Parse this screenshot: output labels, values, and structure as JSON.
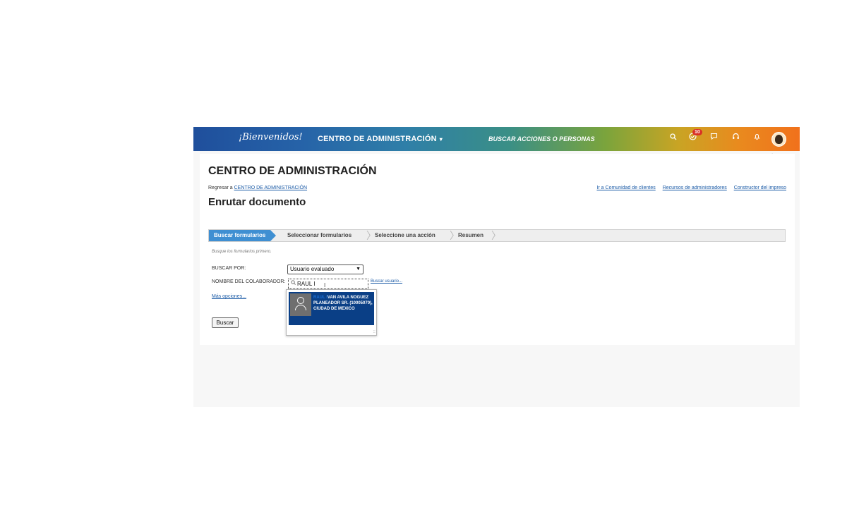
{
  "topbar": {
    "welcome": "¡Bienvenidos!",
    "center_menu": "CENTRO DE ADMINISTRACIÓN",
    "center_menu_caret": "▾",
    "search_placeholder": "BUSCAR ACCIONES O PERSONAS",
    "notification_count": "10",
    "icons": [
      "search-icon",
      "todo-check-icon",
      "chat-icon",
      "headset-icon",
      "bell-icon",
      "avatar"
    ]
  },
  "page": {
    "heading": "CENTRO DE ADMINISTRACIÓN",
    "back_prefix": "Regresar a",
    "back_link": "CENTRO DE ADMINISTRACIÓN",
    "top_links": [
      "Ir a Comunidad de clientes",
      "Recursos de administradores",
      "Constructor del impreso"
    ],
    "title": "Enrutar documento"
  },
  "steps": [
    "Buscar formularios",
    "Seleccionar formularios",
    "Seleccione una acción",
    "Resumen"
  ],
  "form": {
    "hint": "Busque los formularios primero.",
    "search_by_label": "BUSCAR POR:",
    "search_by_value": "Usuario evaluado",
    "collaborator_label": "NOMBRE DEL COLABORADOR:",
    "collaborator_value": "RAUL I",
    "find_user_link": "Buscar usuario...",
    "more_options": "Más opciones...",
    "search_button": "Buscar"
  },
  "autocomplete": {
    "result_highlight": "RAUL I",
    "result_name": "VAN AVILA NOGUEZ",
    "result_detail": "PLANEADOR SR. (10005070), CIUDAD DE MEXICO"
  },
  "colors": {
    "accent_blue": "#3f8fd2",
    "result_bg": "#0a3f86",
    "badge_red": "#d93025",
    "link_blue": "#1a5aa6"
  }
}
